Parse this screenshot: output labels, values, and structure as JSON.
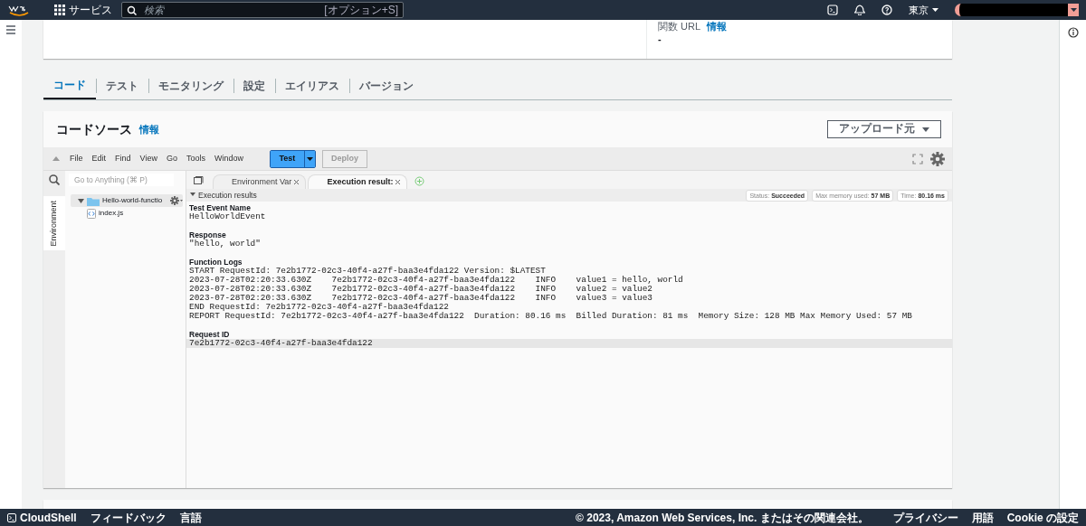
{
  "top_nav": {
    "services": "サービス",
    "search_placeholder": "検索",
    "search_shortcut": "[オプション+S]",
    "region": "東京"
  },
  "function_card": {
    "label": "関数 URL",
    "info_link": "情報",
    "value": "-"
  },
  "tabs": [
    {
      "label": "コード",
      "selected": true
    },
    {
      "label": "テスト",
      "selected": false
    },
    {
      "label": "モニタリング",
      "selected": false
    },
    {
      "label": "設定",
      "selected": false
    },
    {
      "label": "エイリアス",
      "selected": false
    },
    {
      "label": "バージョン",
      "selected": false
    }
  ],
  "code_source": {
    "title": "コードソース",
    "info_link": "情報",
    "upload_button": "アップロード元"
  },
  "ide": {
    "menu": [
      "File",
      "Edit",
      "Find",
      "View",
      "Go",
      "Tools",
      "Window"
    ],
    "test_button": "Test",
    "deploy_button": "Deploy",
    "deploy_disabled": true,
    "goto_placeholder": "Go to Anything (⌘ P)",
    "side_tab": "Environment",
    "tree": [
      {
        "label": "Hello-world-functio",
        "kind": "folder",
        "expanded": true,
        "children": [
          {
            "label": "index.js",
            "kind": "file"
          }
        ]
      }
    ],
    "editor_tabs": [
      {
        "label": "Environment Var",
        "selected": false
      },
      {
        "label": "Execution result:",
        "selected": true
      }
    ],
    "results": {
      "title": "Execution results",
      "expanded": true,
      "status_label": "Status:",
      "status": "Succeeded",
      "memory_label": "Max memory used:",
      "memory": "57 MB",
      "time_label": "Time:",
      "time": "80.16 ms",
      "sections": [
        {
          "heading": "Test Event Name",
          "lines": [
            "HelloWorldEvent"
          ],
          "active": false
        },
        {
          "heading": "Response",
          "lines": [
            "\"hello, world\""
          ],
          "active": false
        },
        {
          "heading": "Function Logs",
          "lines": [
            "START RequestId: 7e2b1772-02c3-40f4-a27f-baa3e4fda122 Version: $LATEST",
            "2023-07-28T02:20:33.630Z    7e2b1772-02c3-40f4-a27f-baa3e4fda122    INFO    value1 = hello, world",
            "2023-07-28T02:20:33.630Z    7e2b1772-02c3-40f4-a27f-baa3e4fda122    INFO    value2 = value2",
            "2023-07-28T02:20:33.630Z    7e2b1772-02c3-40f4-a27f-baa3e4fda122    INFO    value3 = value3",
            "END RequestId: 7e2b1772-02c3-40f4-a27f-baa3e4fda122",
            "REPORT RequestId: 7e2b1772-02c3-40f4-a27f-baa3e4fda122  Duration: 80.16 ms  Billed Duration: 81 ms  Memory Size: 128 MB Max Memory Used: 57 MB"
          ],
          "active": false
        },
        {
          "heading": "Request ID",
          "lines": [
            "7e2b1772-02c3-40f4-a27f-baa3e4fda122"
          ],
          "active": true
        }
      ]
    }
  },
  "footer": {
    "cloudshell": "CloudShell",
    "feedback": "フィードバック",
    "language": "言語",
    "copyright": "© 2023, Amazon Web Services, Inc. またはその関連会社。",
    "links": [
      "プライバシー",
      "用語",
      "Cookie の設定"
    ]
  }
}
